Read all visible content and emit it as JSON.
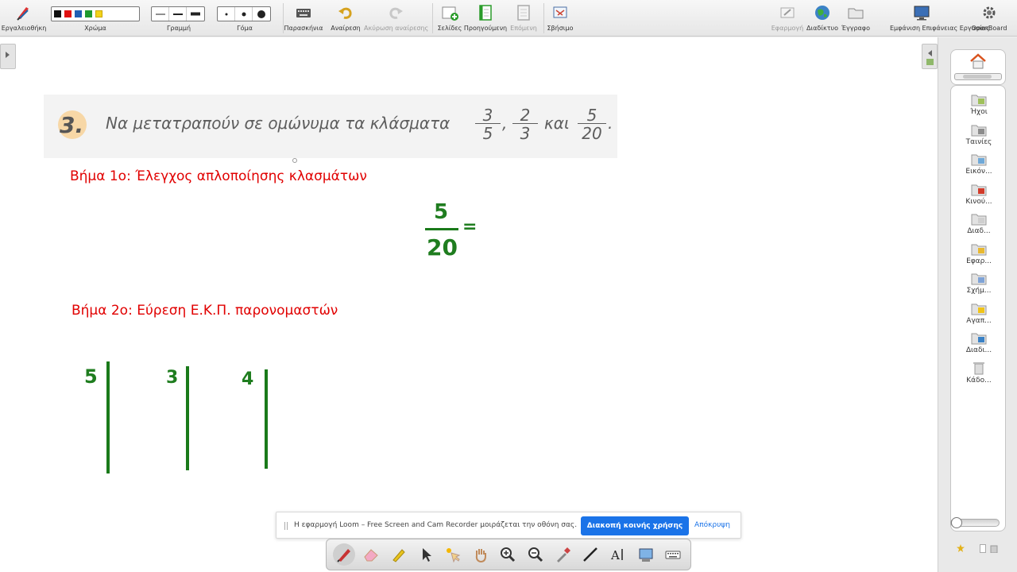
{
  "toolbar": {
    "tools_label": "Εργαλειοθήκη",
    "color_label": "Χρώμα",
    "line_label": "Γραμμή",
    "eraser_label": "Γόμα",
    "display_label": "Παρασκήνια",
    "undo_label": "Αναίρεση",
    "redo_label": "Ακύρωση αναίρεσης",
    "pages_label": "Σελίδες",
    "previous_label": "Προηγούμενη",
    "next_label": "Επόμενη",
    "erase_label": "Σβήσιμο",
    "app_label": "Εφαρμογή",
    "internet_label": "Διαδίκτυο",
    "document_label": "Έγγραφο",
    "show_desktop_label": "Εμφάνιση Επιφάνειας Εργασίας",
    "openboard_label": "OpenBoard",
    "colors": [
      "#111111",
      "#e01010",
      "#1f5fb3",
      "#1f9a2f",
      "#f2d21a"
    ]
  },
  "exercise": {
    "number": "3.",
    "text": "Να μετατραπούν σε ομώνυμα τα κλάσματα",
    "fractions": [
      {
        "num": "3",
        "den": "5"
      },
      {
        "num": "2",
        "den": "3"
      },
      {
        "num": "5",
        "den": "20"
      }
    ],
    "comma": ",",
    "and_word": "και",
    "end_dot": "."
  },
  "steps": {
    "step1": "Βήμα 1ο: Έλεγχος απλοποίησης κλασμάτων",
    "step2": "Βήμα 2ο: Εύρεση Ε.Κ.Π. παρονομαστών"
  },
  "handwriting": {
    "fraction_num": "5",
    "fraction_den": "20",
    "equals": "=",
    "den1": "5",
    "den2": "3",
    "den3": "4",
    "color": "#1f7d1f"
  },
  "library": {
    "items": [
      {
        "label": "Ήχοι",
        "icon": "sound-folder-icon"
      },
      {
        "label": "Ταινίες",
        "icon": "movie-folder-icon"
      },
      {
        "label": "Εικόν...",
        "icon": "image-folder-icon"
      },
      {
        "label": "Κινού...",
        "icon": "flash-folder-icon"
      },
      {
        "label": "Διαδ...",
        "icon": "interactive-folder-icon"
      },
      {
        "label": "Εφαρ...",
        "icon": "app-folder-icon"
      },
      {
        "label": "Σχήμ...",
        "icon": "shape-folder-icon"
      },
      {
        "label": "Αγαπ...",
        "icon": "favorite-folder-icon"
      },
      {
        "label": "Διαδι...",
        "icon": "web-folder-icon"
      },
      {
        "label": "Κάδο...",
        "icon": "trash-icon"
      }
    ]
  },
  "loom": {
    "message": "Η εφαρμογή Loom – Free Screen and Cam Recorder μοιράζεται την οθόνη σας.",
    "stop_label": "Διακοπή κοινής χρήσης",
    "hide_label": "Απόκρυψη"
  },
  "bottom_tools": [
    "pen-icon",
    "eraser-icon",
    "marker-icon",
    "pointer-icon",
    "laser-icon",
    "hand-icon",
    "zoom-in-icon",
    "zoom-out-icon",
    "pipette-icon",
    "line-icon",
    "text-icon",
    "capture-icon",
    "keyboard-icon"
  ]
}
